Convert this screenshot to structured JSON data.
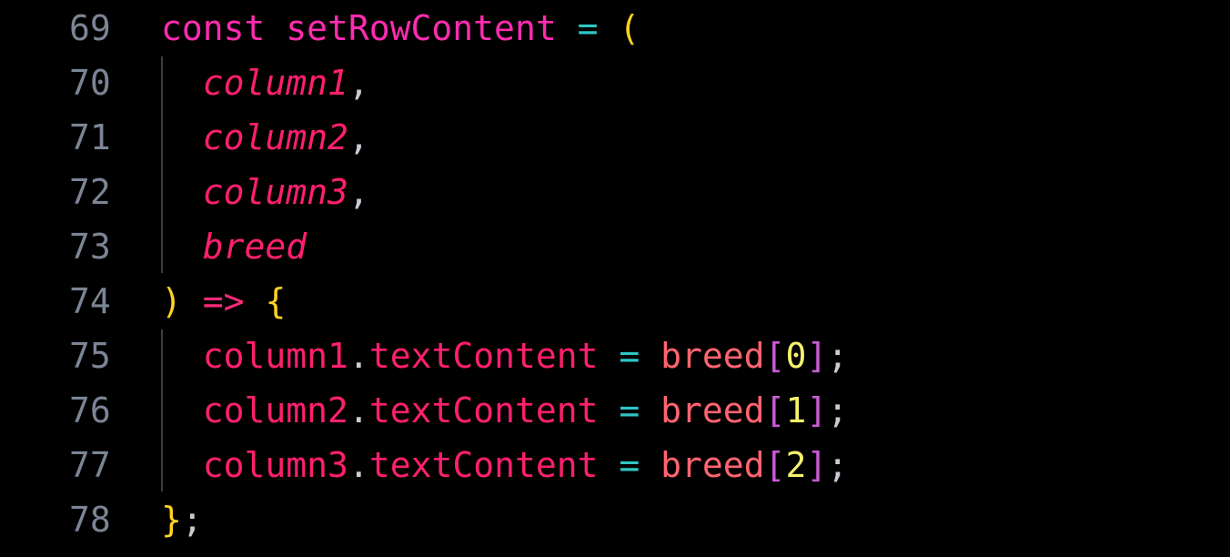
{
  "lines": [
    {
      "n": "69",
      "tokens": [
        {
          "t": "const",
          "c": "kw"
        },
        {
          "t": " ",
          "c": "punct"
        },
        {
          "t": "setRowContent",
          "c": "fn"
        },
        {
          "t": " ",
          "c": "punct"
        },
        {
          "t": "=",
          "c": "op"
        },
        {
          "t": " ",
          "c": "punct"
        },
        {
          "t": "(",
          "c": "paren"
        }
      ]
    },
    {
      "n": "70",
      "tokens": [
        {
          "t": "  ",
          "c": "punct"
        },
        {
          "t": "column1",
          "c": "param"
        },
        {
          "t": ",",
          "c": "punct"
        }
      ]
    },
    {
      "n": "71",
      "tokens": [
        {
          "t": "  ",
          "c": "punct"
        },
        {
          "t": "column2",
          "c": "param"
        },
        {
          "t": ",",
          "c": "punct"
        }
      ]
    },
    {
      "n": "72",
      "tokens": [
        {
          "t": "  ",
          "c": "punct"
        },
        {
          "t": "column3",
          "c": "param"
        },
        {
          "t": ",",
          "c": "punct"
        }
      ]
    },
    {
      "n": "73",
      "tokens": [
        {
          "t": "  ",
          "c": "punct"
        },
        {
          "t": "breed",
          "c": "param"
        }
      ]
    },
    {
      "n": "74",
      "tokens": [
        {
          "t": ")",
          "c": "paren"
        },
        {
          "t": " ",
          "c": "punct"
        },
        {
          "t": "=>",
          "c": "arrow"
        },
        {
          "t": " ",
          "c": "punct"
        },
        {
          "t": "{",
          "c": "paren"
        }
      ]
    },
    {
      "n": "75",
      "tokens": [
        {
          "t": "  ",
          "c": "punct"
        },
        {
          "t": "column1",
          "c": "var"
        },
        {
          "t": ".",
          "c": "punct"
        },
        {
          "t": "textContent",
          "c": "prop"
        },
        {
          "t": " ",
          "c": "punct"
        },
        {
          "t": "=",
          "c": "op"
        },
        {
          "t": " ",
          "c": "punct"
        },
        {
          "t": "breed",
          "c": "ident2"
        },
        {
          "t": "[",
          "c": "bracket"
        },
        {
          "t": "0",
          "c": "num"
        },
        {
          "t": "]",
          "c": "bracket"
        },
        {
          "t": ";",
          "c": "punct"
        }
      ]
    },
    {
      "n": "76",
      "tokens": [
        {
          "t": "  ",
          "c": "punct"
        },
        {
          "t": "column2",
          "c": "var"
        },
        {
          "t": ".",
          "c": "punct"
        },
        {
          "t": "textContent",
          "c": "prop"
        },
        {
          "t": " ",
          "c": "punct"
        },
        {
          "t": "=",
          "c": "op"
        },
        {
          "t": " ",
          "c": "punct"
        },
        {
          "t": "breed",
          "c": "ident2"
        },
        {
          "t": "[",
          "c": "bracket"
        },
        {
          "t": "1",
          "c": "num"
        },
        {
          "t": "]",
          "c": "bracket"
        },
        {
          "t": ";",
          "c": "punct"
        }
      ]
    },
    {
      "n": "77",
      "tokens": [
        {
          "t": "  ",
          "c": "punct"
        },
        {
          "t": "column3",
          "c": "var"
        },
        {
          "t": ".",
          "c": "punct"
        },
        {
          "t": "textContent",
          "c": "prop"
        },
        {
          "t": " ",
          "c": "punct"
        },
        {
          "t": "=",
          "c": "op"
        },
        {
          "t": " ",
          "c": "punct"
        },
        {
          "t": "breed",
          "c": "ident2"
        },
        {
          "t": "[",
          "c": "bracket"
        },
        {
          "t": "2",
          "c": "num"
        },
        {
          "t": "]",
          "c": "bracket"
        },
        {
          "t": ";",
          "c": "punct"
        }
      ]
    },
    {
      "n": "78",
      "tokens": [
        {
          "t": "}",
          "c": "paren"
        },
        {
          "t": ";",
          "c": "punct"
        }
      ]
    }
  ],
  "colors": {
    "background": "#000000",
    "line_number": "#7b8594",
    "keyword": "#ff2bb0",
    "operator": "#2ec5c5",
    "paren": "#ffd21f",
    "parameter": "#ff1f6e",
    "number": "#f6f26d",
    "bracket": "#c95bd6"
  }
}
